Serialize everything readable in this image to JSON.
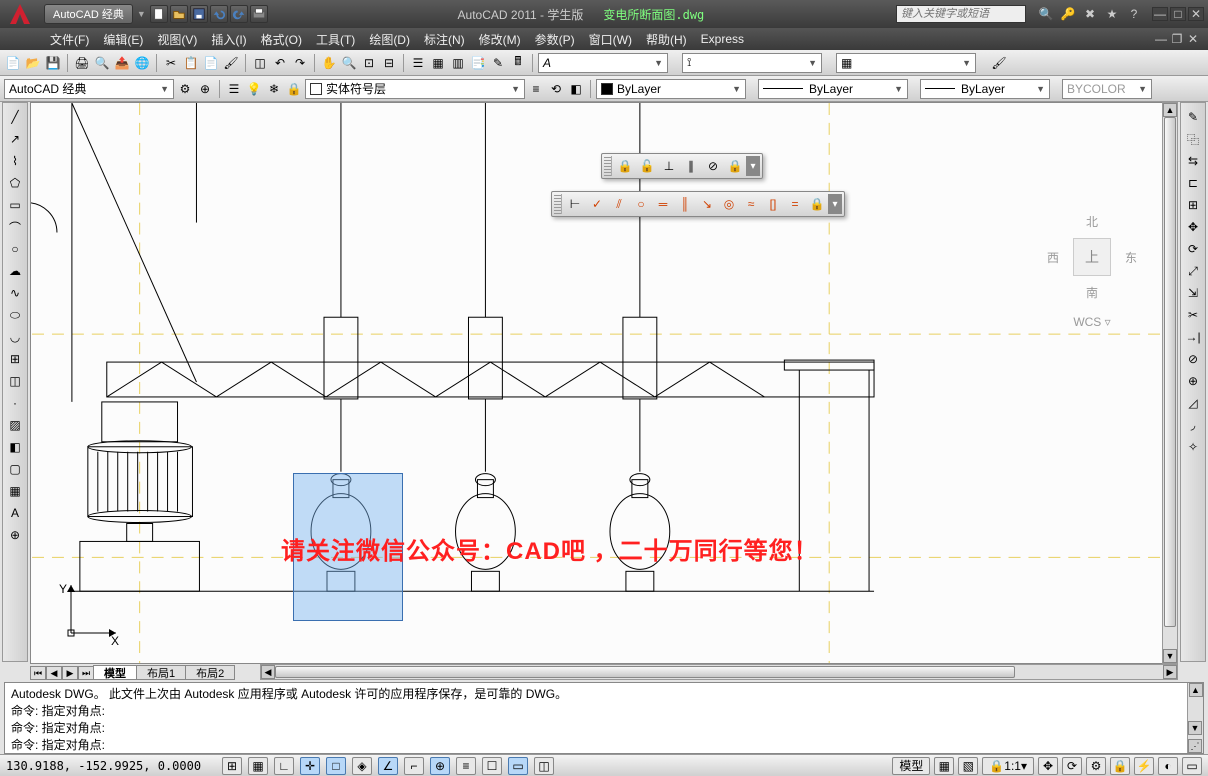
{
  "title": {
    "workspace_pill": "AutoCAD 经典",
    "app": "AutoCAD 2011 - 学生版",
    "file": "变电所断面图.dwg",
    "search_placeholder": "键入关键字或短语"
  },
  "menu": {
    "items": [
      "文件(F)",
      "编辑(E)",
      "视图(V)",
      "插入(I)",
      "格式(O)",
      "工具(T)",
      "绘图(D)",
      "标注(N)",
      "修改(M)",
      "参数(P)",
      "窗口(W)",
      "帮助(H)",
      "Express"
    ]
  },
  "row2": {
    "workspace": "AutoCAD 经典",
    "layer_name": "实体符号层",
    "linetype_label": "ByLayer",
    "lineweight_label": "ByLayer",
    "color_label": "ByLayer",
    "plotstyle": "BYCOLOR"
  },
  "layout_tabs": {
    "model": "模型",
    "layout1": "布局1",
    "layout2": "布局2"
  },
  "viewcube": {
    "north": "北",
    "south": "南",
    "east": "东",
    "west": "西",
    "top": "上",
    "wcs": "WCS"
  },
  "overlay": "请关注微信公众号：CAD吧 ，二十万同行等您！",
  "command": {
    "history": [
      "Autodesk DWG。 此文件上次由 Autodesk 应用程序或 Autodesk 许可的应用程序保存，是可靠的 DWG。",
      "命令: 指定对角点:",
      "命令: 指定对角点:"
    ],
    "prompt": "命令: 指定对角点:"
  },
  "status": {
    "coords": "130.9188, -152.9925, 0.0000",
    "tab_model": "模型",
    "scale": "1:1"
  }
}
